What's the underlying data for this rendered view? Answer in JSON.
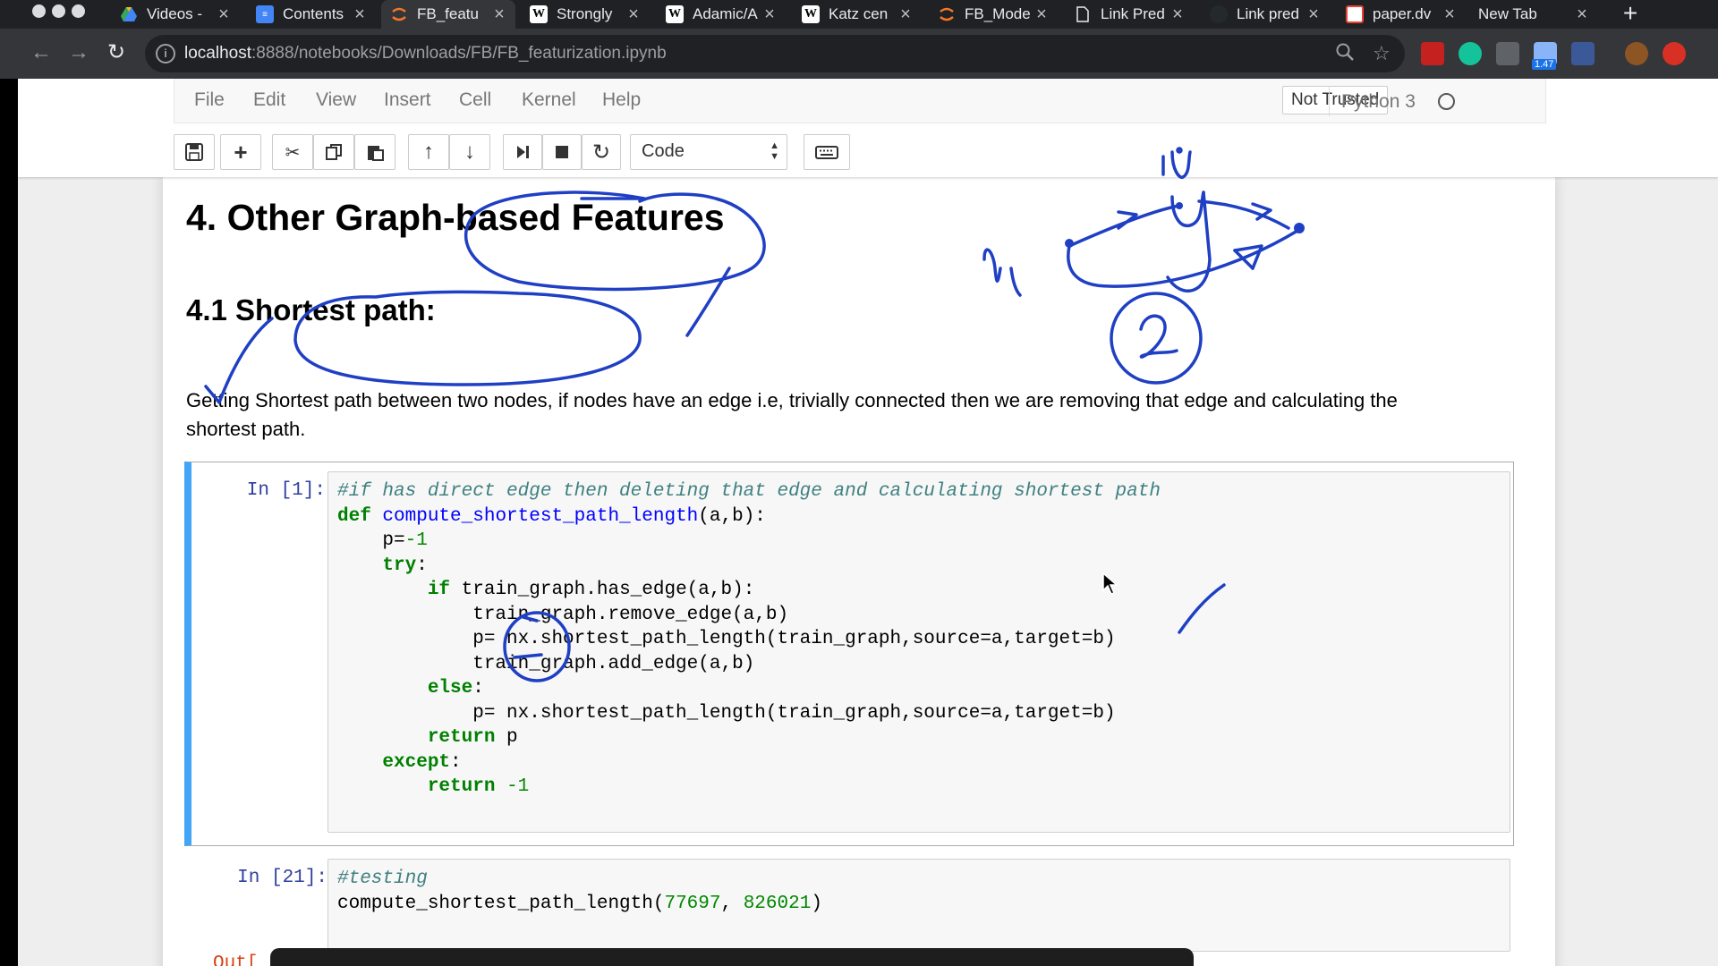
{
  "browser": {
    "tabs": [
      {
        "title": "Videos -",
        "icon": "google-drive-icon",
        "active": false
      },
      {
        "title": "Contents",
        "icon": "google-docs-icon",
        "active": false
      },
      {
        "title": "FB_featu",
        "icon": "jupyter-icon",
        "active": true
      },
      {
        "title": "Strongly",
        "icon": "wikipedia-icon",
        "active": false
      },
      {
        "title": "Adamic/A",
        "icon": "wikipedia-icon",
        "active": false
      },
      {
        "title": "Katz cen",
        "icon": "wikipedia-icon",
        "active": false
      },
      {
        "title": "FB_Mode",
        "icon": "jupyter-icon",
        "active": false
      },
      {
        "title": "Link Pred",
        "icon": "document-icon",
        "active": false
      },
      {
        "title": "Link pred",
        "icon": "github-icon",
        "active": false
      },
      {
        "title": "paper.dv",
        "icon": "pdf-icon",
        "active": false
      },
      {
        "title": "New Tab",
        "icon": "",
        "active": false
      }
    ],
    "url_host": "localhost",
    "url_path": ":8888/notebooks/Downloads/FB/FB_featurization.ipynb",
    "extension_badge": "1.47"
  },
  "jupyter": {
    "menu": [
      "File",
      "Edit",
      "View",
      "Insert",
      "Cell",
      "Kernel",
      "Help"
    ],
    "trust_status": "Not Trusted",
    "kernel_name": "Python 3",
    "cell_type": "Code"
  },
  "notebook": {
    "heading": "4. Other Graph-based Features",
    "subheading": "4.1 Shortest path:",
    "description": "Getting Shortest path between two nodes, if nodes have an edge i.e, trivially connected then we are removing that edge and calculating the shortest path.",
    "cells": [
      {
        "prompt": "In [1]:"
      },
      {
        "prompt": "In [21]:"
      }
    ],
    "output_prompt": "Out["
  },
  "annotations": {
    "ink_color": "#1f3fc4",
    "handwritten_labels": [
      "ui",
      "uj",
      "ul",
      "2"
    ]
  }
}
